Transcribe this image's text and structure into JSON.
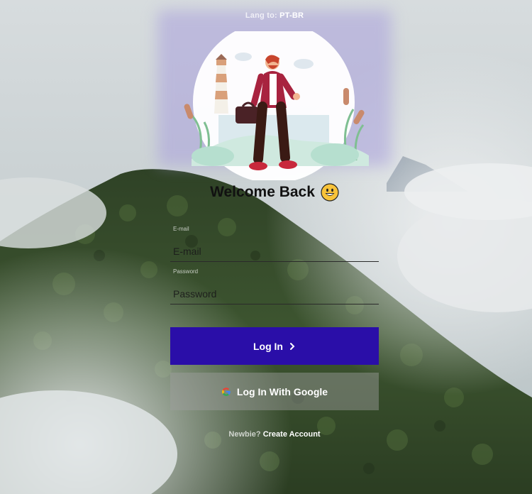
{
  "language": {
    "label": "Lang to:",
    "value": "PT-BR"
  },
  "hero": {
    "illustration": "man-with-briefcase-lighthouse"
  },
  "welcome": {
    "title": "Welcome Back",
    "emoji": "grinning-face-icon"
  },
  "form": {
    "email": {
      "label": "E-mail",
      "placeholder": "E-mail",
      "value": ""
    },
    "password": {
      "label": "Password",
      "placeholder": "Password",
      "value": ""
    }
  },
  "actions": {
    "login_label": "Log In",
    "login_icon": "chevron-right-icon",
    "google_label": "Log In With Google",
    "google_icon": "google-icon"
  },
  "footer": {
    "prompt": "Newbie?",
    "link": "Create Account"
  },
  "colors": {
    "primary_button": "#2a0ea8",
    "secondary_button": "rgba(160,160,160,0.45)"
  }
}
